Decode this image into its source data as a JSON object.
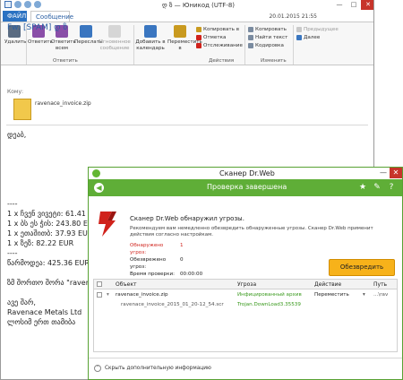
{
  "outlook": {
    "title": "დ ზ — Юникод (UTF-8)",
    "window_buttons": {
      "minimize": "—",
      "maximize": "□",
      "close": "✕"
    },
    "tabs": {
      "file": "ФАЙЛ",
      "message": "Сообщение"
    },
    "ribbon": {
      "delete": "Удалить",
      "reply": "Ответить",
      "reply_all": "Ответить всем",
      "forward": "Переслать",
      "im": "Мгновенное сообщение",
      "add_calendar": "Добавить в календарь",
      "move_to": "Переместить в",
      "copy_to": "Копировать в",
      "mark": "Отметка",
      "followup": "Отслеживание",
      "copy": "Копировать",
      "find_text": "Найти текст",
      "encoding": "Кодировка",
      "prev": "Предыдущее",
      "next": "Далее",
      "groups": {
        "respond": "Ответить",
        "actions": "Действия",
        "edit": "Изменить"
      }
    },
    "message": {
      "date": "20.01.2015 21:55",
      "subject": "Fw: [SPAM] დ ზ",
      "to_label": "Кому:",
      "attachment": "ravenace_invoice.zip",
      "body_lines": [
        "დეაბ,",
        "",
        "",
        "",
        "",
        "",
        "",
        "----",
        "1 x ჩვენ ვივეტი: 61.41 EUR",
        "1 x ბს ეს ჭის: 243.80 EUR",
        "1 x ეთაშითბ: 37.93 EUR",
        "1 x ზეზ: 82.22 EUR",
        "----",
        "წარმოდეა: 425.36 EUR",
        "",
        "ზმ შორთო შორა \"ravenace.",
        "",
        "ავე შარ,",
        "Ravenace Metals Ltd",
        "ლოსიმ ერთ თამიბა"
      ]
    }
  },
  "drweb": {
    "title": "Сканер Dr.Web",
    "window_buttons": {
      "minimize": "—",
      "close": "✕"
    },
    "bar_title": "Проверка завершена",
    "headline": "Сканер Dr.Web обнаружил угрозы.",
    "description": "Рекомендуем вам немедленно обезвредить обнаруженные угрозы. Сканер Dr.Web применит действия согласно настройкам.",
    "stats": [
      {
        "label": "Обнаружено угроз:",
        "value": "1",
        "alert": true
      },
      {
        "label": "Обезврежено угроз:",
        "value": "0",
        "alert": false
      },
      {
        "label": "Время проверки:",
        "value": "00:00:00",
        "alert": false
      }
    ],
    "neutralize_button": "Обезвредить",
    "table": {
      "columns": [
        "Объект",
        "Угроза",
        "Действие",
        "Путь"
      ],
      "rows": [
        {
          "object": "ravenace_invoice.zip",
          "threat": "Инфицированный архив",
          "action": "Переместить",
          "path": "...\\rav"
        },
        {
          "object": "ravenace_invoice_2015_01_20-12_54.scr",
          "threat": "Trojan.DownLoad3.35539",
          "action": "",
          "path": ""
        }
      ]
    },
    "footer": "Скрыть дополнительную информацию",
    "colors": {
      "brand_green": "#5fae37",
      "alert_red": "#d0221b",
      "button_orange": "#f7b21a"
    }
  }
}
